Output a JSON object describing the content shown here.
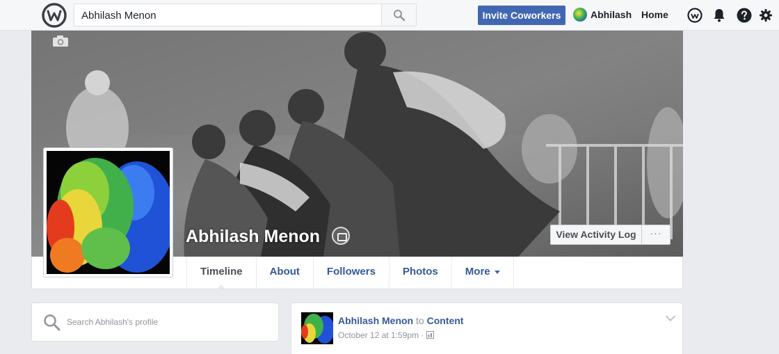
{
  "topbar": {
    "search_value": "Abhilash Menon",
    "invite_label": "Invite Coworkers",
    "user_name": "Abhilash",
    "home_label": "Home",
    "accent_color": "#4267b2"
  },
  "profile": {
    "name": "Abhilash Menon",
    "view_activity_log": "View Activity Log",
    "more_options": "···"
  },
  "tabs": [
    {
      "label": "Timeline",
      "active": true
    },
    {
      "label": "About"
    },
    {
      "label": "Followers"
    },
    {
      "label": "Photos"
    },
    {
      "label": "More"
    }
  ],
  "sidebar": {
    "search_placeholder": "Search Abhilash's profile"
  },
  "post": {
    "author": "Abhilash Menon",
    "connector": "to",
    "group": "Content",
    "timestamp": "October 12 at 1:59pm",
    "privacy_icon": "group-privacy-icon"
  }
}
